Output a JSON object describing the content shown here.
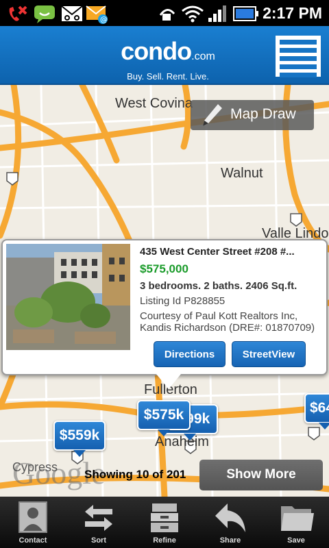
{
  "status_bar": {
    "time": "2:17 PM"
  },
  "header": {
    "logo_main": "condo",
    "logo_suffix": ".com",
    "tagline": "Buy. Sell. Rent. Live."
  },
  "map": {
    "cities": [
      "West Covina",
      "Walnut",
      "Valle Lindo",
      "Fullerton",
      "Anaheim",
      "Cypress"
    ],
    "map_draw_label": "Map Draw",
    "price_tags": [
      "$575k",
      "$559k",
      "$599k",
      "$64"
    ],
    "attribution": "Google",
    "showing_text": "Showing 10 of 201",
    "show_more_label": "Show More"
  },
  "popup": {
    "title": "435 West Center Street #208 #...",
    "price": "$575,000",
    "details": "3 bedrooms. 2 baths. 2406 Sq.ft.",
    "listing_id": "Listing Id P828855",
    "courtesy": "Courtesy of Paul Kott Realtors Inc, Kandis Richardson (DRE#: 01870709)",
    "directions_label": "Directions",
    "streetview_label": "StreetView"
  },
  "toolbar": {
    "items": [
      {
        "label": "Contact",
        "icon": "contact-icon"
      },
      {
        "label": "Sort",
        "icon": "sort-icon"
      },
      {
        "label": "Refine",
        "icon": "refine-icon"
      },
      {
        "label": "Share",
        "icon": "share-icon"
      },
      {
        "label": "Save",
        "icon": "save-icon"
      }
    ]
  },
  "colors": {
    "header_blue": "#1674c4",
    "price_green": "#1a9b2a",
    "road_orange": "#f6a833"
  }
}
